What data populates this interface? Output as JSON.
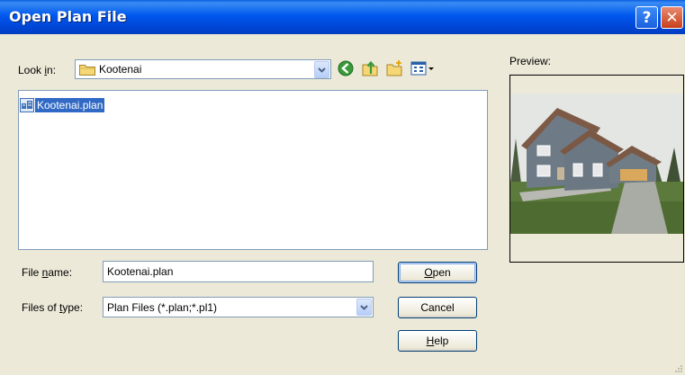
{
  "window": {
    "title": "Open Plan File"
  },
  "titlebar": {
    "help_label": "?",
    "close_label": "✕"
  },
  "look_in": {
    "label_pre": "Look ",
    "label_key": "i",
    "label_post": "n:",
    "value": "Kootenai"
  },
  "file_list": {
    "items": [
      {
        "name": "Kootenai.plan",
        "selected": true
      }
    ]
  },
  "preview": {
    "label": "Preview:"
  },
  "file_name": {
    "label_pre": "File ",
    "label_key": "n",
    "label_post": "ame:",
    "value": "Kootenai.plan"
  },
  "file_type": {
    "label_pre": "Files of ",
    "label_key": "t",
    "label_post": "ype:",
    "value": "Plan Files (*.plan;*.pl1)"
  },
  "buttons": {
    "open": {
      "key": "O",
      "rest": "pen"
    },
    "cancel": {
      "label": "Cancel"
    },
    "help": {
      "key": "H",
      "rest": "elp"
    }
  },
  "toolbar": {
    "icons": [
      "back-icon",
      "up-folder-icon",
      "new-folder-icon",
      "view-menu-icon"
    ]
  },
  "colors": {
    "title_bar": "#0058ee",
    "selection": "#316ac5",
    "dialog_bg": "#ece9d8"
  }
}
